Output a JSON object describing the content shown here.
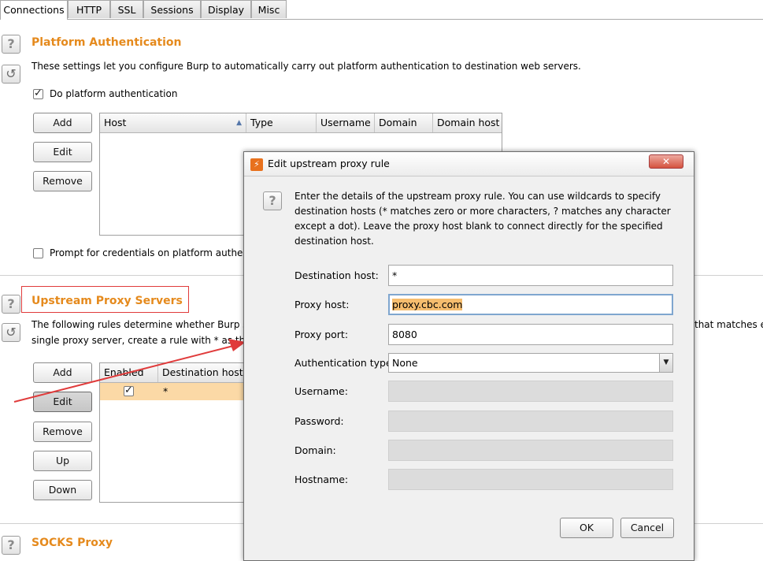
{
  "tabs": [
    {
      "label": "Connections",
      "active": true
    },
    {
      "label": "HTTP",
      "active": false
    },
    {
      "label": "SSL",
      "active": false
    },
    {
      "label": "Sessions",
      "active": false
    },
    {
      "label": "Display",
      "active": false
    },
    {
      "label": "Misc",
      "active": false
    }
  ],
  "icons": {
    "help": "?",
    "reset": "↺",
    "check": "✓",
    "burp": "⚡",
    "close": "✕",
    "sort_asc": "▲",
    "dropdown": "▼"
  },
  "platform_auth": {
    "title": "Platform Authentication",
    "description": "These settings let you configure Burp to automatically carry out platform authentication to destination web servers.",
    "do_auth_label": "Do platform authentication",
    "do_auth_checked": true,
    "buttons": {
      "add": "Add",
      "edit": "Edit",
      "remove": "Remove"
    },
    "columns": [
      "Host",
      "Type",
      "Username",
      "Domain",
      "Domain host"
    ],
    "prompt_label": "Prompt for credentials on platform authent",
    "prompt_checked": false
  },
  "upstream": {
    "title": "Upstream Proxy Servers",
    "description_part1": "The following rules determine whether Burp se",
    "description_part2": "that matches e",
    "description_line2": "single proxy server, create a rule with * as the d",
    "buttons": {
      "add": "Add",
      "edit": "Edit",
      "remove": "Remove",
      "up": "Up",
      "down": "Down"
    },
    "columns": [
      "Enabled",
      "Destination host"
    ],
    "rows": [
      {
        "enabled": true,
        "destination_host": "*"
      }
    ]
  },
  "socks": {
    "title": "SOCKS Proxy"
  },
  "dialog": {
    "title": "Edit upstream proxy rule",
    "description": "Enter the details of the upstream proxy rule. You can use wildcards to specify destination hosts (* matches zero or more characters, ? matches any character except a dot). Leave the proxy host blank to connect directly for the specified destination host.",
    "fields": {
      "destination_host": {
        "label": "Destination host:",
        "value": "*"
      },
      "proxy_host": {
        "label": "Proxy host:",
        "value": "proxy.cbc.com"
      },
      "proxy_port": {
        "label": "Proxy port:",
        "value": "8080"
      },
      "auth_type": {
        "label": "Authentication type:",
        "value": "None"
      },
      "username": {
        "label": "Username:",
        "value": ""
      },
      "password": {
        "label": "Password:",
        "value": ""
      },
      "domain": {
        "label": "Domain:",
        "value": ""
      },
      "hostname": {
        "label": "Hostname:",
        "value": ""
      }
    },
    "ok_label": "OK",
    "cancel_label": "Cancel"
  },
  "colors": {
    "accent": "#e58a1d",
    "highlight": "#f6bd6e",
    "selected_row": "#fbd9a6",
    "annotation": "#e03b3b"
  }
}
